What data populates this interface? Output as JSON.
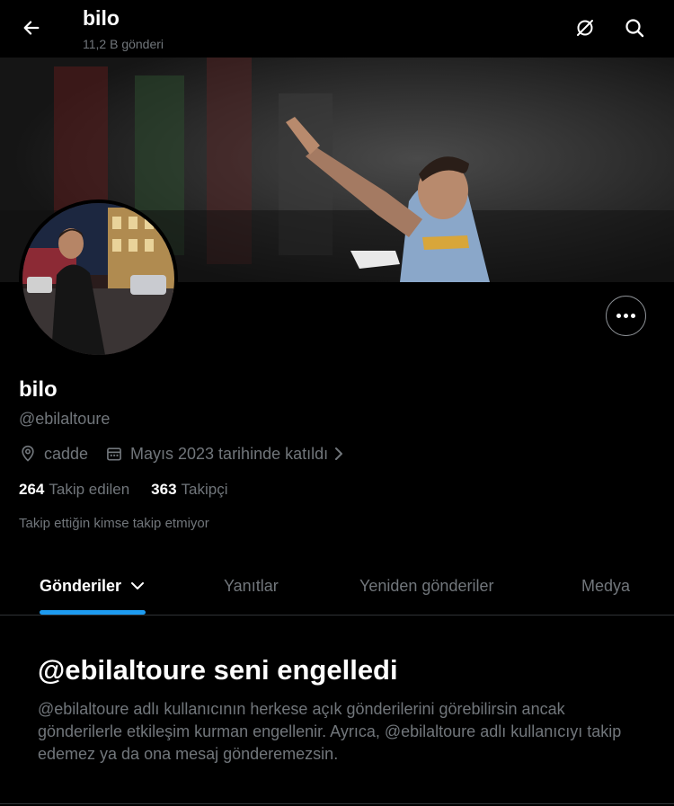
{
  "header": {
    "title": "bilo",
    "subtitle": "11,2 B gönderi",
    "back_icon": "arrow-left-icon",
    "filter_icon": "circle-slash-icon",
    "search_icon": "search-icon"
  },
  "profile": {
    "name": "bilo",
    "handle": "@ebilaltoure",
    "location": "cadde",
    "joined": "Mayıs 2023 tarihinde katıldı",
    "following_count": "264",
    "following_label": "Takip edilen",
    "followers_count": "363",
    "followers_label": "Takipçi",
    "followed_by_note": "Takip ettiğin kimse takip etmiyor"
  },
  "tabs": [
    {
      "label": "Gönderiler",
      "active": true
    },
    {
      "label": "Yanıtlar",
      "active": false
    },
    {
      "label": "Yeniden gönderiler",
      "active": false
    },
    {
      "label": "Medya",
      "active": false
    }
  ],
  "blocked": {
    "title": "@ebilaltoure seni engelledi",
    "body": "@ebilaltoure adlı kullanıcının herkese açık gönderilerini görebilirsin ancak gönderilerle etkileşim kurman engellenir. Ayrıca, @ebilaltoure adlı kullanıcıyı takip edemez ya da ona mesaj gönderemezsin."
  },
  "colors": {
    "background": "#000000",
    "text_primary": "#e7e9ea",
    "text_secondary": "#71767b",
    "accent": "#1d9bf0",
    "divider": "#2f3336"
  }
}
